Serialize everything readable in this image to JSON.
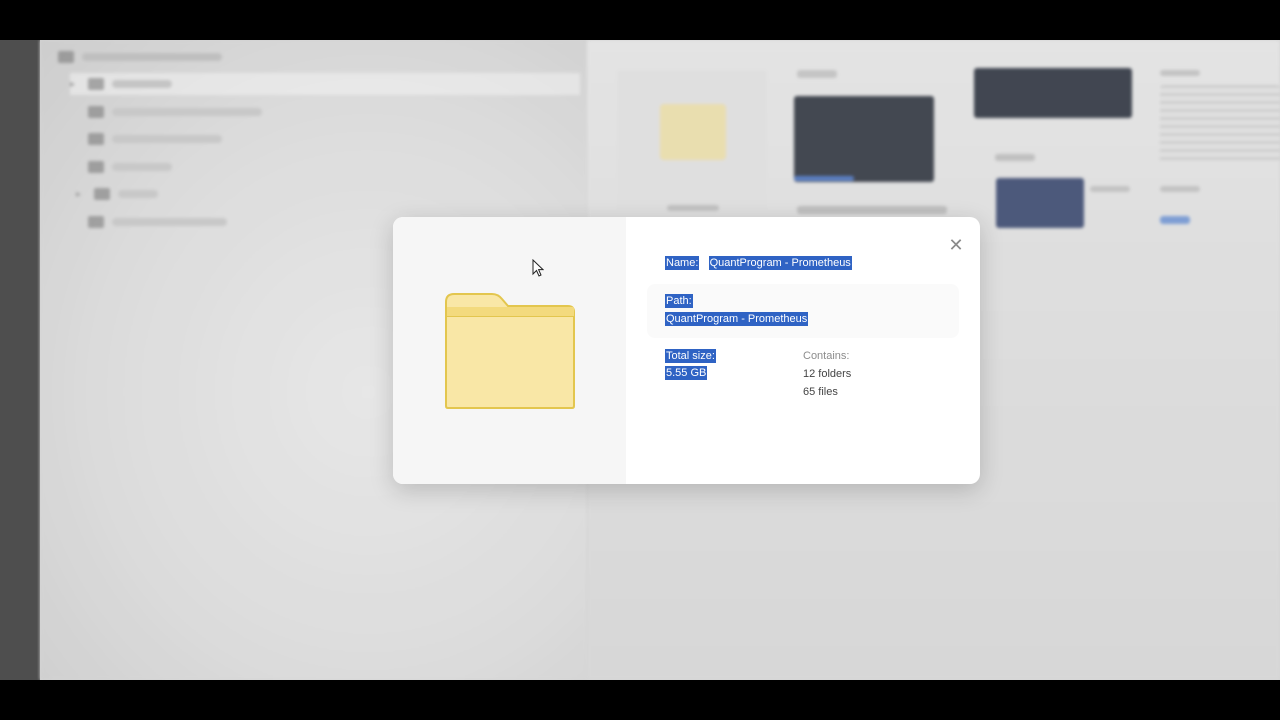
{
  "dialog": {
    "name_label": "Name:",
    "name_value": "QuantProgram - Prometheus",
    "path_label": "Path:",
    "path_value": "QuantProgram - Prometheus",
    "size_label": "Total size:",
    "size_value": "5.55 GB",
    "contains_label": "Contains:",
    "contains_folders": "12 folders",
    "contains_files": "65 files",
    "close_icon": "close-icon"
  },
  "colors": {
    "selection": "#2f63c4",
    "folder_fill": "#f9e7a6",
    "folder_stroke": "#e3c64e"
  }
}
